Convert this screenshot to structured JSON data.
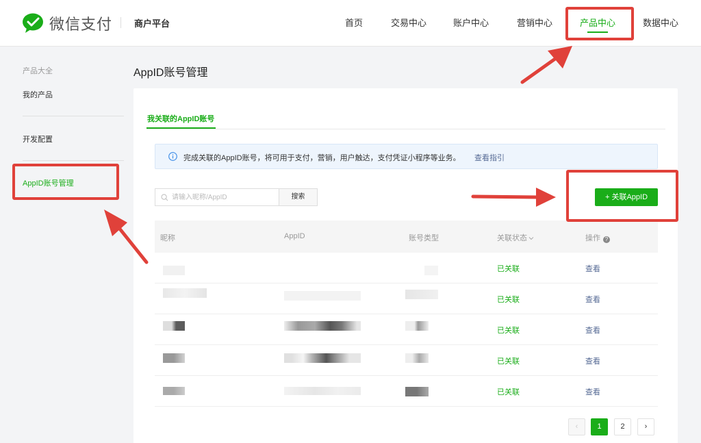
{
  "header": {
    "logo_text": "微信支付",
    "platform": "商户平台",
    "nav": [
      {
        "label": "首页"
      },
      {
        "label": "交易中心"
      },
      {
        "label": "账户中心"
      },
      {
        "label": "营销中心"
      },
      {
        "label": "产品中心",
        "active": true
      },
      {
        "label": "数据中心"
      }
    ]
  },
  "sidebar": {
    "group_title": "产品大全",
    "items": [
      {
        "label": "我的产品"
      },
      {
        "label": "开发配置"
      },
      {
        "label": "AppID账号管理",
        "active": true
      }
    ]
  },
  "main": {
    "title": "AppID账号管理",
    "tab": "我关联的AppID账号",
    "notice": {
      "text": "完成关联的AppID账号，将可用于支付，营销，用户触达，支付凭证小程序等业务。",
      "link": "查看指引"
    },
    "search": {
      "placeholder": "请输入昵称/AppID",
      "button": "搜索"
    },
    "link_button": "+ 关联AppID",
    "table": {
      "columns": [
        "昵称",
        "AppID",
        "账号类型",
        "关联状态",
        "操作"
      ],
      "rows": [
        {
          "status": "已关联",
          "action": "查看"
        },
        {
          "status": "已关联",
          "action": "查看"
        },
        {
          "status": "已关联",
          "action": "查看"
        },
        {
          "status": "已关联",
          "action": "查看"
        },
        {
          "status": "已关联",
          "action": "查看"
        }
      ]
    },
    "pagination": {
      "prev": "‹",
      "pages": [
        "1",
        "2"
      ],
      "current": "1",
      "next": "›"
    }
  },
  "colors": {
    "accent": "#1aad19",
    "link": "#576b95",
    "annotation": "#e0413a"
  }
}
